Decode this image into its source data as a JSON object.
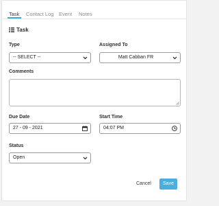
{
  "tabs": [
    {
      "label": "Task",
      "active": true
    },
    {
      "label": "Contact Log",
      "active": false
    },
    {
      "label": "Event",
      "active": false
    },
    {
      "label": "Notes",
      "active": false
    }
  ],
  "section": {
    "title": "Task",
    "icon": "list-icon"
  },
  "fields": {
    "type": {
      "label": "Type",
      "value": "-- SELECT --"
    },
    "assigned_to": {
      "label": "Assigned To",
      "value": "Matt Cabban FR"
    },
    "comments": {
      "label": "Comments",
      "value": ""
    },
    "due_date": {
      "label": "Due Date",
      "value": "27 - 09 - 2021"
    },
    "start_time": {
      "label": "Start Time",
      "value": "04:07 PM"
    },
    "status": {
      "label": "Status",
      "value": "Open"
    }
  },
  "actions": {
    "cancel": "Cancel",
    "save": "Save"
  },
  "colors": {
    "accent": "#4aaee0",
    "tab_underline": "#3aa9d8"
  }
}
